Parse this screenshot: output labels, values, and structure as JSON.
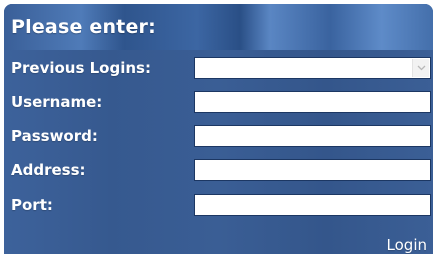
{
  "header": {
    "title": "Please enter:"
  },
  "form": {
    "previous_logins": {
      "label": "Previous Logins:",
      "selected_value": "",
      "arrow_icon": "chevron-down-icon"
    },
    "username": {
      "label": "Username:",
      "value": "",
      "placeholder": ""
    },
    "password": {
      "label": "Password:",
      "value": "",
      "placeholder": ""
    },
    "address": {
      "label": "Address:",
      "value": "",
      "placeholder": ""
    },
    "port": {
      "label": "Port:",
      "value": "",
      "placeholder": ""
    }
  },
  "actions": {
    "login_label": "Login"
  },
  "colors": {
    "panel_bg": "#3a5f96",
    "label_text": "#ffffff",
    "field_border": "#1c3763",
    "field_bg": "#ffffff"
  }
}
